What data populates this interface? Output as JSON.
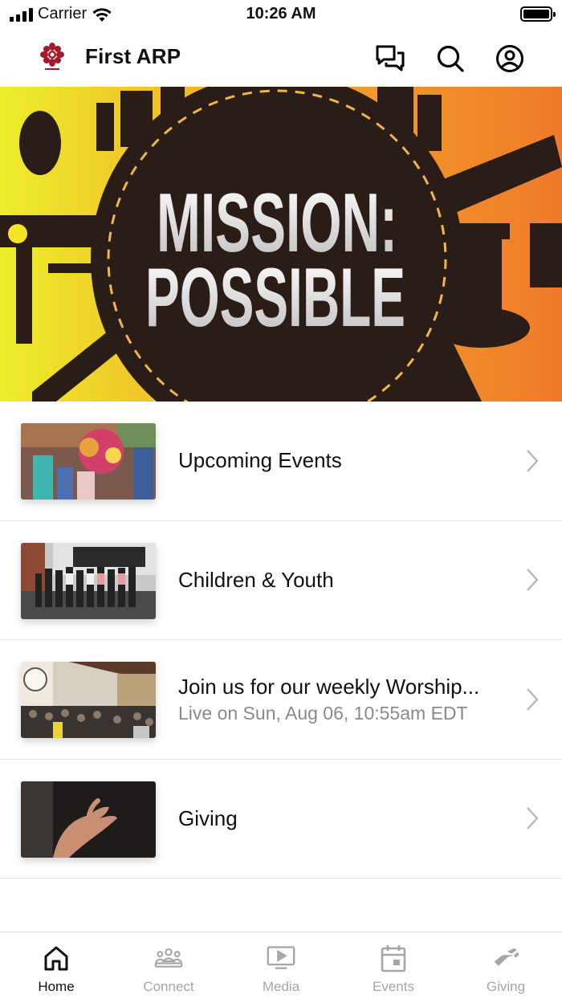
{
  "status_bar": {
    "carrier": "Carrier",
    "time": "10:26 AM"
  },
  "header": {
    "title": "First ARP"
  },
  "hero": {
    "line1": "MISSION:",
    "line2": "POSSIBLE"
  },
  "list": [
    {
      "title": "Upcoming Events",
      "subtitle": ""
    },
    {
      "title": "Children & Youth",
      "subtitle": ""
    },
    {
      "title": "Join us for our weekly Worship...",
      "subtitle": "Live on Sun, Aug 06, 10:55am EDT"
    },
    {
      "title": "Giving",
      "subtitle": ""
    }
  ],
  "tabs": [
    {
      "label": "Home",
      "icon": "home-icon",
      "active": true
    },
    {
      "label": "Connect",
      "icon": "people-icon",
      "active": false
    },
    {
      "label": "Media",
      "icon": "tv-play-icon",
      "active": false
    },
    {
      "label": "Events",
      "icon": "calendar-icon",
      "active": false
    },
    {
      "label": "Giving",
      "icon": "giving-hand-icon",
      "active": false
    }
  ],
  "colors": {
    "logo": "#a4182e",
    "hero_left": "#e8e829",
    "hero_right": "#f07a25",
    "inactive": "#a6a6a6"
  }
}
